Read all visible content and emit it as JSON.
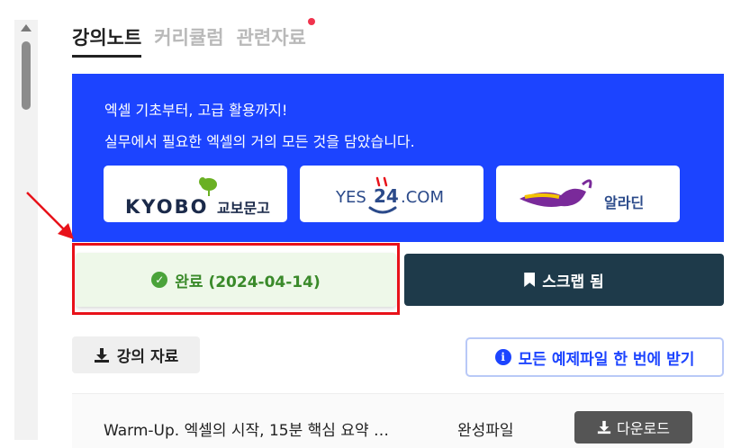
{
  "tabs": [
    {
      "label": "강의노트",
      "active": true
    },
    {
      "label": "커리큘럼",
      "active": false
    },
    {
      "label": "관련자료",
      "active": false,
      "has_dot": true
    }
  ],
  "banner": {
    "line1": "엑셀 기초부터, 고급 활용까지!",
    "line2": "실무에서 필요한 엑셀의 거의 모든 것을 담았습니다.",
    "bg_color": "#1c44ff"
  },
  "stores": {
    "kyobo": {
      "brand": "KYOBO",
      "sub": "교보문고"
    },
    "yes24": {
      "prefix": "YES",
      "num": "24",
      "suffix": ".COM"
    },
    "aladin": {
      "name": "알라딘"
    }
  },
  "status": {
    "done_label": "완료 (2024-04-14)",
    "scrap_label": "스크랩 됨"
  },
  "materials": {
    "label": "강의 자료",
    "all_files_label": "모든 예제파일 한 번에 받기"
  },
  "lectures": [
    {
      "title": "Warm-Up. 엑셀의 시작, 15분 핵심 요약 …",
      "type": "완성파일",
      "download_label": "다운로드"
    }
  ],
  "colors": {
    "accent": "#1c44ff",
    "done_green": "#3a8a2a",
    "scrap_dark": "#1e3a4a",
    "annotation_red": "#e8121a"
  }
}
